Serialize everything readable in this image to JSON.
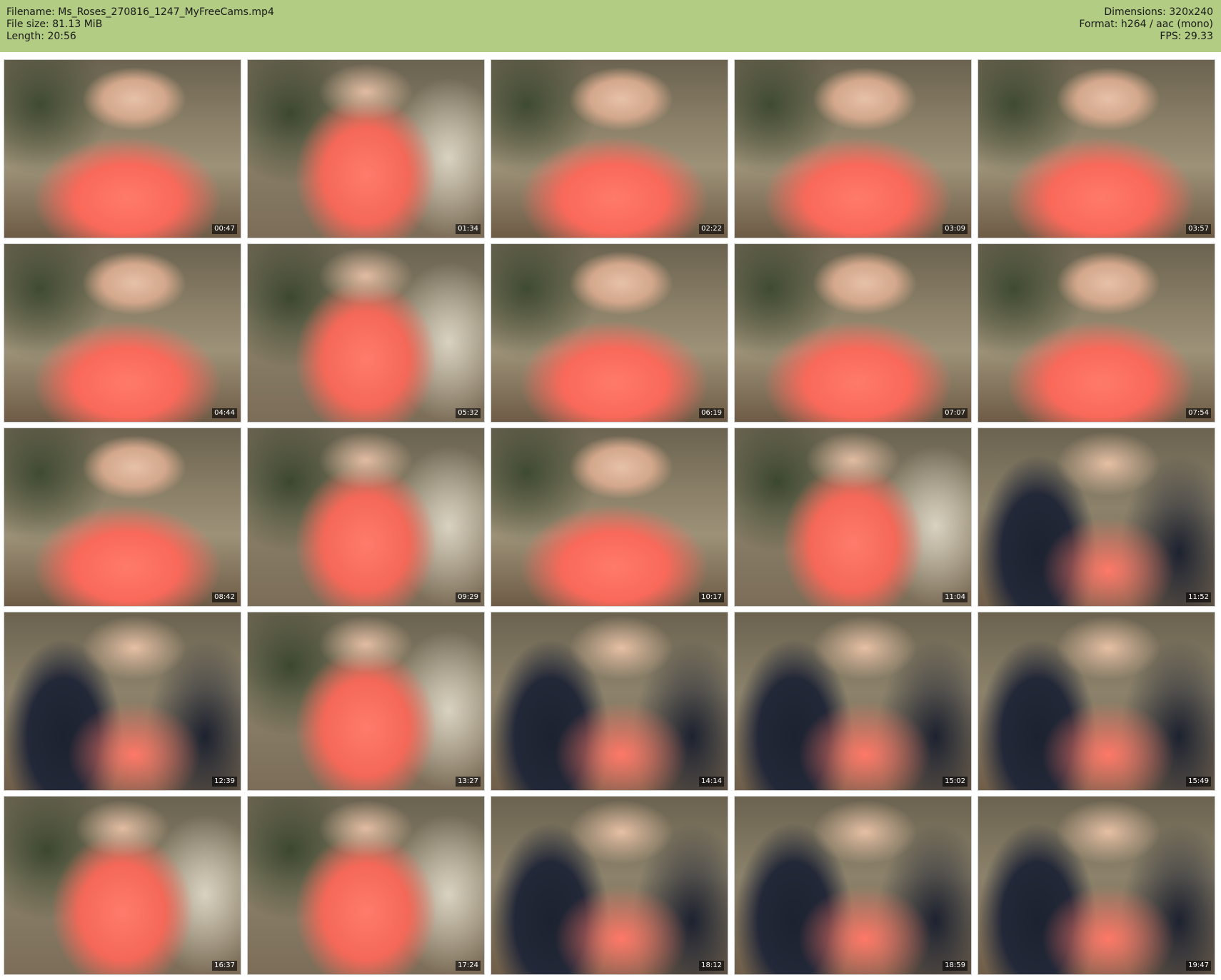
{
  "header": {
    "filename": "Filename: Ms_Roses_270816_1247_MyFreeCams.mp4",
    "file_size": "File size: 81.13 MiB",
    "length": "Length: 20:56",
    "dimensions": "Dimensions: 320x240",
    "format": "Format: h264 / aac (mono)",
    "fps": "FPS: 29.33"
  },
  "thumbnails": [
    {
      "time": "00:47"
    },
    {
      "time": "01:34"
    },
    {
      "time": "02:22"
    },
    {
      "time": "03:09"
    },
    {
      "time": "03:57"
    },
    {
      "time": "04:44"
    },
    {
      "time": "05:32"
    },
    {
      "time": "06:19"
    },
    {
      "time": "07:07"
    },
    {
      "time": "07:54"
    },
    {
      "time": "08:42"
    },
    {
      "time": "09:29"
    },
    {
      "time": "10:17"
    },
    {
      "time": "11:04"
    },
    {
      "time": "11:52"
    },
    {
      "time": "12:39"
    },
    {
      "time": "13:27"
    },
    {
      "time": "14:14"
    },
    {
      "time": "15:02"
    },
    {
      "time": "15:49"
    },
    {
      "time": "16:37"
    },
    {
      "time": "17:24"
    },
    {
      "time": "18:12"
    },
    {
      "time": "18:59"
    },
    {
      "time": "19:47"
    }
  ]
}
